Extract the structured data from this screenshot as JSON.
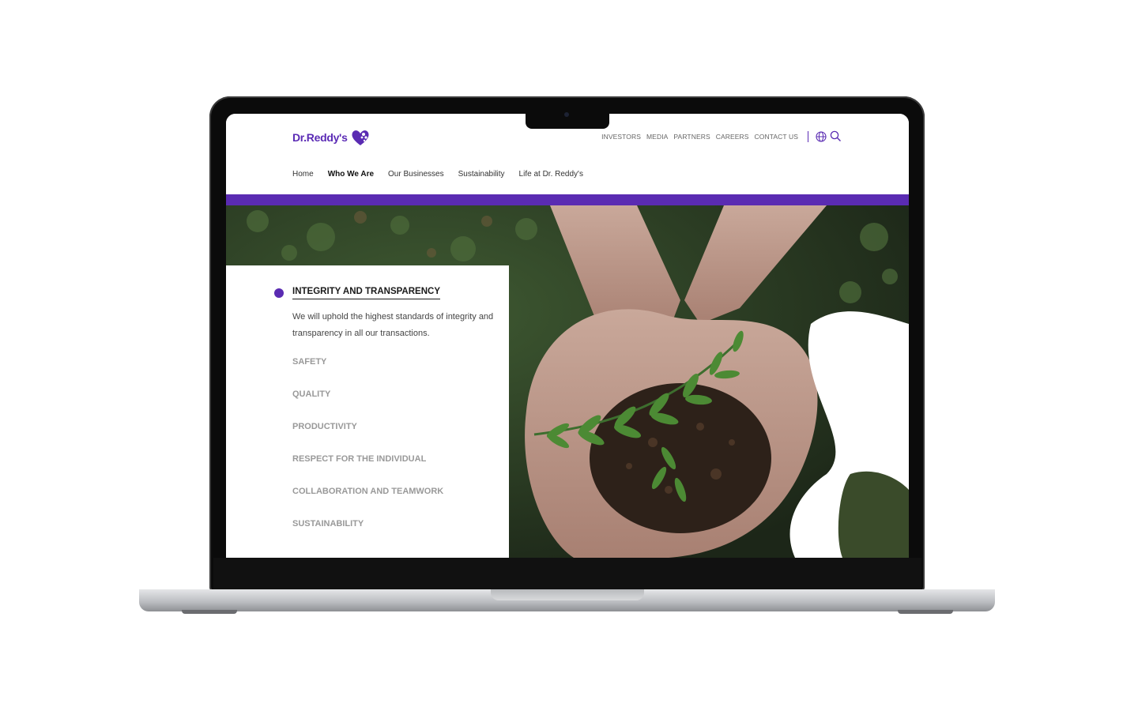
{
  "header": {
    "logo_text": "Dr.Reddy's",
    "utility_links": [
      "INVESTORS",
      "MEDIA",
      "PARTNERS",
      "CAREERS",
      "CONTACT US"
    ],
    "main_nav": [
      "Home",
      "Who We Are",
      "Our Businesses",
      "Sustainability",
      "Life at Dr. Reddy's"
    ],
    "active_nav": "Who We Are"
  },
  "values": {
    "active_title": "INTEGRITY AND TRANSPARENCY",
    "active_description": "We will uphold the highest standards of integrity and transparency in all our transactions.",
    "items": [
      "SAFETY",
      "QUALITY",
      "PRODUCTIVITY",
      "RESPECT FOR THE INDIVIDUAL",
      "COLLABORATION AND TEAMWORK",
      "SUSTAINABILITY"
    ]
  },
  "colors": {
    "brand_purple": "#5a2bb2",
    "text_muted": "#999999"
  },
  "icons": [
    "globe-icon",
    "search-icon",
    "heart-logo-icon"
  ]
}
